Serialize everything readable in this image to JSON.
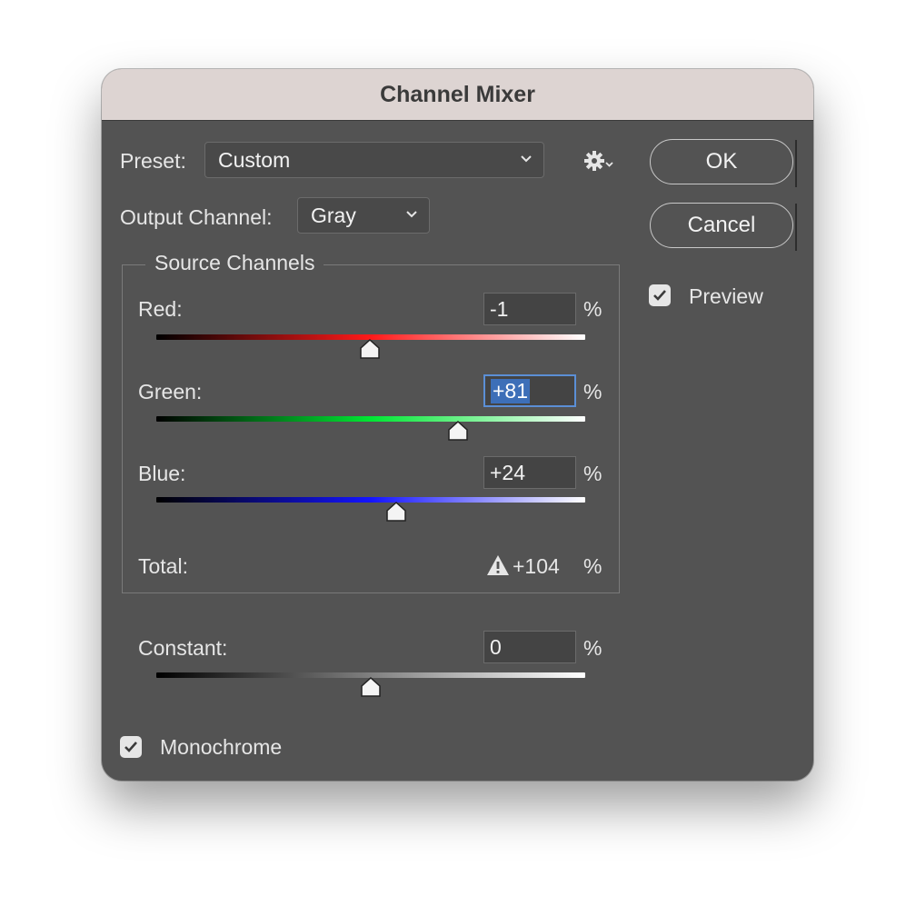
{
  "dialog": {
    "title": "Channel Mixer"
  },
  "preset": {
    "label": "Preset:",
    "value": "Custom"
  },
  "output_channel": {
    "label": "Output Channel:",
    "value": "Gray"
  },
  "buttons": {
    "ok": "OK",
    "cancel": "Cancel"
  },
  "preview": {
    "label": "Preview",
    "checked": true
  },
  "source_channels": {
    "title": "Source Channels",
    "red": {
      "label": "Red:",
      "value": "-1",
      "unit": "%",
      "level": -1
    },
    "green": {
      "label": "Green:",
      "value": "+81",
      "unit": "%",
      "level": 81
    },
    "blue": {
      "label": "Blue:",
      "value": "+24",
      "unit": "%",
      "level": 24
    },
    "total": {
      "label": "Total:",
      "value": "+104",
      "unit": "%",
      "warning_icon": "warning-triangle-icon"
    }
  },
  "constant": {
    "label": "Constant:",
    "value": "0",
    "unit": "%",
    "level": 0
  },
  "monochrome": {
    "label": "Monochrome",
    "checked": true
  },
  "colors": {
    "dialog_bg": "#535353",
    "titlebar_bg": "#ddd4d2",
    "focus": "#3d6fb8"
  },
  "icons": {
    "settings": "gear-icon",
    "dropdown": "chevron-down-icon",
    "check": "checkmark-icon"
  }
}
